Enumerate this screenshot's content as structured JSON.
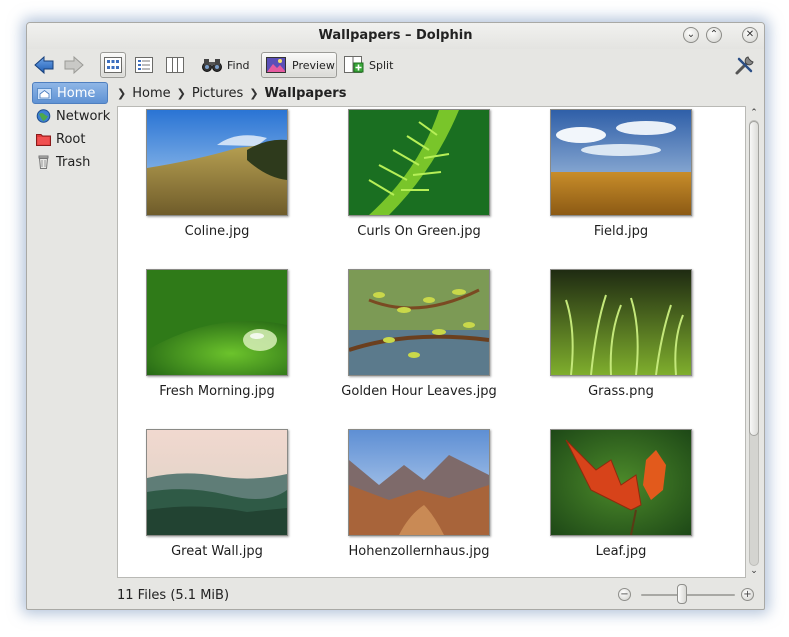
{
  "window": {
    "title": "Wallpapers – Dolphin"
  },
  "titlebar_buttons": {
    "minimize_glyph": "⌄",
    "maximize_glyph": "⌃",
    "close_glyph": "✕"
  },
  "toolbar": {
    "find_label": "Find",
    "preview_label": "Preview",
    "split_label": "Split"
  },
  "places": [
    {
      "label": "Home",
      "icon": "home-folder-icon"
    },
    {
      "label": "Network",
      "icon": "network-globe-icon"
    },
    {
      "label": "Root",
      "icon": "root-folder-icon"
    },
    {
      "label": "Trash",
      "icon": "trash-icon"
    }
  ],
  "breadcrumb": {
    "items": [
      "Home",
      "Pictures"
    ],
    "current": "Wallpapers"
  },
  "files": [
    {
      "name": "Coline.jpg"
    },
    {
      "name": "Curls On Green.jpg"
    },
    {
      "name": "Field.jpg"
    },
    {
      "name": "Fresh Morning.jpg"
    },
    {
      "name": "Golden Hour Leaves.jpg"
    },
    {
      "name": "Grass.png"
    },
    {
      "name": "Great Wall.jpg"
    },
    {
      "name": "Hohenzollernhaus.jpg"
    },
    {
      "name": "Leaf.jpg"
    }
  ],
  "status": {
    "text": "11 Files (5.1 MiB)",
    "zoom_minus": "−",
    "zoom_plus": "+"
  },
  "colors": {
    "selection": "#5f92d4",
    "window_bg": "#e6e6e3",
    "view_bg": "#ffffff"
  }
}
